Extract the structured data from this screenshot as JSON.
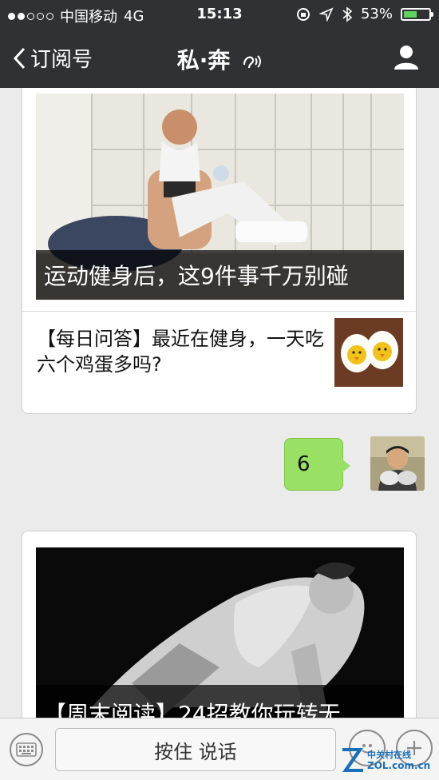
{
  "status_bar": {
    "carrier": "中国移动",
    "network": "4G",
    "time": "15:13",
    "battery": "53%",
    "battery_level": 0.53
  },
  "nav": {
    "back_label": "订阅号",
    "title": "私·奔"
  },
  "articles": {
    "top_caption": "运动健身后，这9件事千万别碰",
    "sub_title": "【每日问答】最近在健身，一天吃六个鸡蛋多吗?",
    "bottom_caption": "【周末阅读】24招教你玩转无"
  },
  "message": {
    "text": "6"
  },
  "toolbar": {
    "talk_label": "按住 说话"
  },
  "watermark": {
    "cn": "中关村在线",
    "en": "ZOL.com.cn"
  },
  "colors": {
    "nav_bg": "#2f3134",
    "bubble_green": "#98e165",
    "battery_green": "#5fd35f"
  }
}
